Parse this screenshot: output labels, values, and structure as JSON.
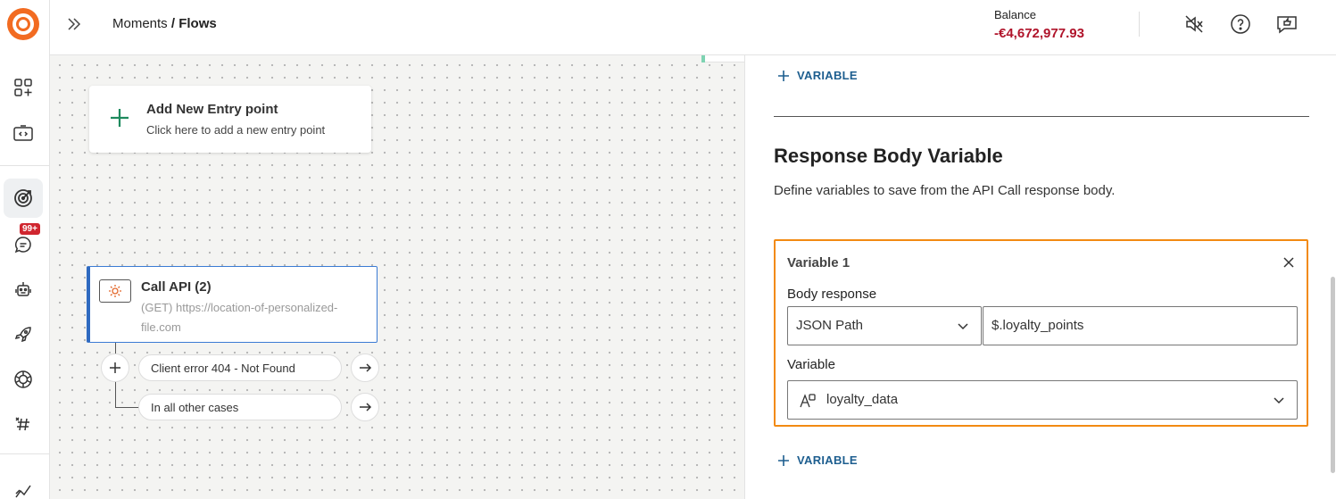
{
  "topbar": {
    "breadcrumb_parent": "Moments",
    "breadcrumb_separator": " / ",
    "breadcrumb_current": "Flows",
    "balance_label": "Balance",
    "balance_value": "-€4,672,977.93"
  },
  "sidebar": {
    "badge": "99+",
    "icons": [
      "apps-add-icon",
      "code-window-icon",
      "target-icon",
      "chat-icon",
      "robot-icon",
      "rocket-icon",
      "openai-icon",
      "hashtag-icon",
      "analytics-icon"
    ]
  },
  "canvas": {
    "entry_title": "Add New Entry point",
    "entry_subtitle": "Click here to add a new entry point",
    "api_title": "Call API (2)",
    "api_url": "(GET) https://location-of-personalized-file.com",
    "branches": [
      "Client error 404 - Not Found",
      "In all other cases"
    ]
  },
  "panel": {
    "add_variable_label": "VARIABLE",
    "section_title": "Response Body Variable",
    "section_description": "Define variables to save from the API Call response body.",
    "variable_card": {
      "title": "Variable 1",
      "body_response_label": "Body response",
      "body_response_type": "JSON Path",
      "body_response_path": "$.loyalty_points",
      "variable_label": "Variable",
      "variable_value": "loyalty_data"
    }
  },
  "colors": {
    "brand": "#f26b21",
    "balance": "#b0142b",
    "link": "#1d5e8f",
    "highlight_border": "#f28a12",
    "node_border": "#2f6ac0"
  }
}
